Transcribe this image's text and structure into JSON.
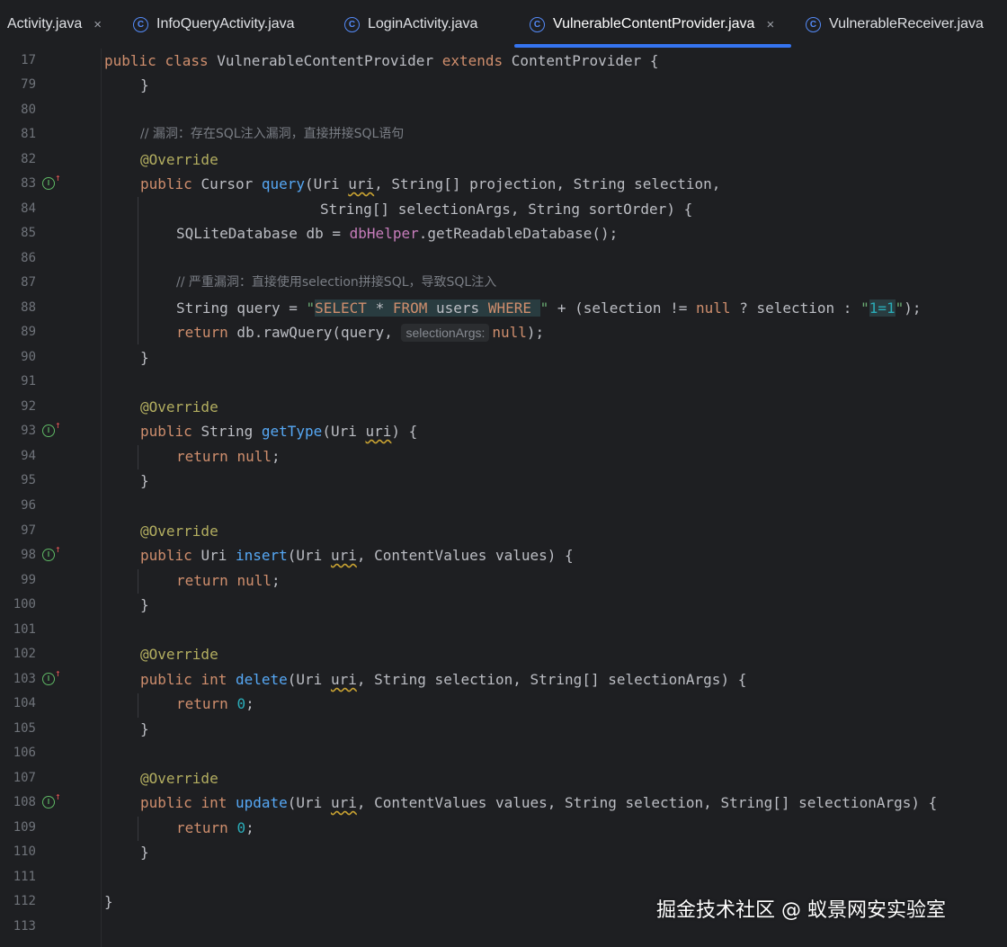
{
  "tabs": [
    {
      "label": "Activity.java",
      "icon": "class-icon",
      "closable": true
    },
    {
      "label": "InfoQueryActivity.java",
      "icon": "class-icon",
      "closable": false
    },
    {
      "label": "LoginActivity.java",
      "icon": "class-icon",
      "closable": false
    },
    {
      "label": "VulnerableContentProvider.java",
      "icon": "class-icon",
      "closable": true,
      "active": true
    },
    {
      "label": "VulnerableReceiver.java",
      "icon": "class-icon",
      "closable": false
    }
  ],
  "tab_icon_letter": "C",
  "close_glyph": "×",
  "override_marker_letter": "I",
  "override_marker_arrow": "↑",
  "line_numbers": [
    "17",
    "79",
    "80",
    "81",
    "82",
    "83",
    "84",
    "85",
    "86",
    "87",
    "88",
    "89",
    "90",
    "91",
    "92",
    "93",
    "94",
    "95",
    "96",
    "97",
    "98",
    "99",
    "100",
    "101",
    "102",
    "103",
    "104",
    "105",
    "106",
    "107",
    "108",
    "109",
    "110",
    "111",
    "112",
    "113"
  ],
  "code": {
    "l17": {
      "kw1": "public",
      "kw2": "class",
      "name": "VulnerableContentProvider",
      "kw3": "extends",
      "parent": "ContentProvider {"
    },
    "l79": "}",
    "l81": "// 漏洞：存在SQL注入漏洞，直接拼接SQL语句",
    "annotation": "@Override",
    "l83": {
      "kw": "public",
      "type": "Cursor",
      "fn": "query",
      "p1": "(Uri ",
      "uri": "uri",
      "rest": ", String[] projection, String selection,"
    },
    "l84": "String[] selectionArgs, String sortOrder) {",
    "l85": {
      "a": "SQLiteDatabase db = ",
      "field": "dbHelper",
      "b": ".getReadableDatabase();"
    },
    "l87": "// 严重漏洞：直接使用selection拼接SQL，导致SQL注入",
    "l88": {
      "a": "String query = ",
      "q": "\"",
      "sql_kw1": "SELECT",
      "sql_star": " * ",
      "sql_kw2": "FROM",
      "sql_tbl": " users ",
      "sql_kw3": "WHERE",
      "sql_end": " ",
      "q2": "\"",
      "b": " + (selection != ",
      "null": "null",
      "c": " ? selection : ",
      "q3": "\"",
      "lit": "1=1",
      "q4": "\"",
      "d": ");"
    },
    "l89": {
      "kw": "return",
      "a": " db.rawQuery(query, ",
      "hint": "selectionArgs:",
      "null": "null",
      "b": ");"
    },
    "close": "}",
    "l93": {
      "kw": "public",
      "type": "String",
      "fn": "getType",
      "p1": "(Uri ",
      "uri": "uri",
      "rest": ") {"
    },
    "return_kw": "return",
    "null_kw": "null",
    "zero": "0",
    "semi": ";",
    "l98": {
      "kw": "public",
      "type": "Uri",
      "fn": "insert",
      "p1": "(Uri ",
      "uri": "uri",
      "rest": ", ContentValues values) {"
    },
    "l103": {
      "kw": "public",
      "kw2": "int",
      "fn": "delete",
      "p1": "(Uri ",
      "uri": "uri",
      "rest": ", String selection, String[] selectionArgs) {"
    },
    "l108": {
      "kw": "public",
      "kw2": "int",
      "fn": "update",
      "p1": "(Uri ",
      "uri": "uri",
      "rest": ", ContentValues values, String selection, String[] selectionArgs) {"
    }
  },
  "watermark": "掘金技术社区 @ 蚁景网安实验室",
  "colors": {
    "background": "#1e1f22",
    "keyword": "#cf8e6d",
    "function": "#56a8f5",
    "string": "#6aab73",
    "annotation": "#b3ae60",
    "number": "#2aacb8",
    "field": "#c77dbb",
    "comment": "#7a7e85",
    "tab_accent": "#3574f0"
  }
}
